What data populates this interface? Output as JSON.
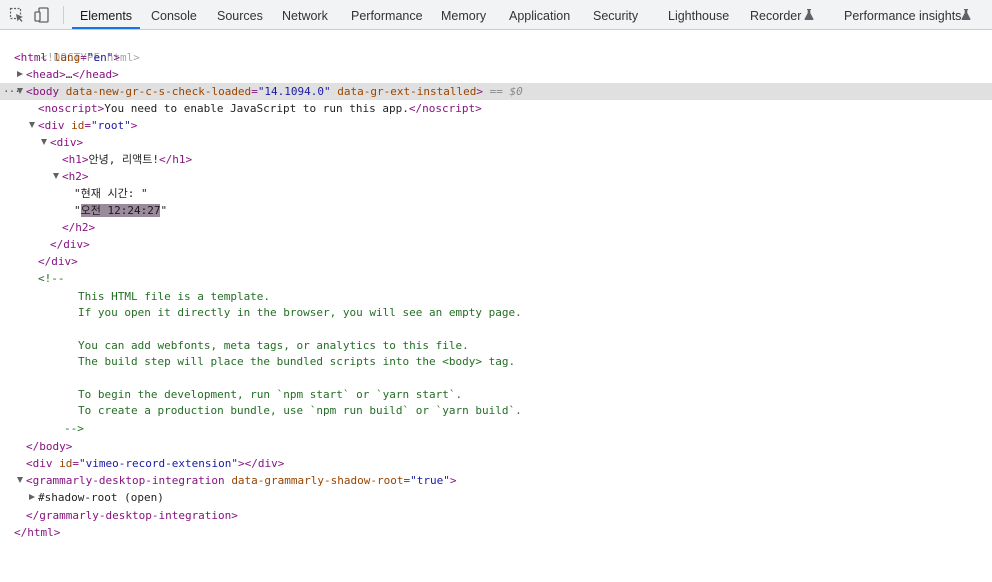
{
  "toolbar": {
    "tabs": [
      {
        "label": "Elements",
        "active": true
      },
      {
        "label": "Console"
      },
      {
        "label": "Sources"
      },
      {
        "label": "Network"
      },
      {
        "label": "Performance"
      },
      {
        "label": "Memory"
      },
      {
        "label": "Application"
      },
      {
        "label": "Security"
      },
      {
        "label": "Lighthouse"
      },
      {
        "label": "Recorder"
      },
      {
        "label": "Performance insights"
      }
    ]
  },
  "dom": {
    "doctype": "<!DOCTYPE html>",
    "html_open": "<html",
    "html_attr": "lang",
    "html_attr_val": "\"en\"",
    "html_close_bracket": ">",
    "head_open": "<head>",
    "head_ellipsis": "…",
    "head_close": "</head>",
    "body_open": "<body",
    "body_attr1": "data-new-gr-c-s-check-loaded",
    "body_attr1_val": "\"14.1094.0\"",
    "body_attr2": "data-gr-ext-installed",
    "body_close_bracket": ">",
    "body_marker": "== $0",
    "noscript_open": "<noscript>",
    "noscript_text": "You need to enable JavaScript to run this app.",
    "noscript_close": "</noscript>",
    "div_root_open": "<div",
    "div_root_attr": "id",
    "div_root_val": "\"root\"",
    "div_open": "<div>",
    "h1_open": "<h1>",
    "h1_text": "안녕, 리액트!",
    "h1_close": "</h1>",
    "h2_open": "<h2>",
    "h2_text1": "\"현재 시간: \"",
    "h2_text2_quote_open": "\"",
    "h2_text2_value": "오전 12:24:27",
    "h2_text2_quote_close": "\"",
    "h2_close": "</h2>",
    "div_close": "</div>",
    "root_close": "</div>",
    "comment_open": "<!--",
    "comment_lines": [
      "This HTML file is a template.",
      "If you open it directly in the browser, you will see an empty page.",
      "",
      "You can add webfonts, meta tags, or analytics to this file.",
      "The build step will place the bundled scripts into the <body> tag.",
      "",
      "To begin the development, run `npm start` or `yarn start`.",
      "To create a production bundle, use `npm run build` or `yarn build`."
    ],
    "comment_close": "-->",
    "body_close": "</body>",
    "vimeo_open": "<div",
    "vimeo_attr": "id",
    "vimeo_val": "\"vimeo-record-extension\"",
    "vimeo_close": "></div>",
    "grammarly_open": "<grammarly-desktop-integration",
    "grammarly_attr": "data-grammarly-shadow-root",
    "grammarly_val": "\"true\"",
    "grammarly_bracket": ">",
    "shadow_root": "#shadow-root (open)",
    "grammarly_close": "</grammarly-desktop-integration>",
    "html_close": "</html>"
  }
}
